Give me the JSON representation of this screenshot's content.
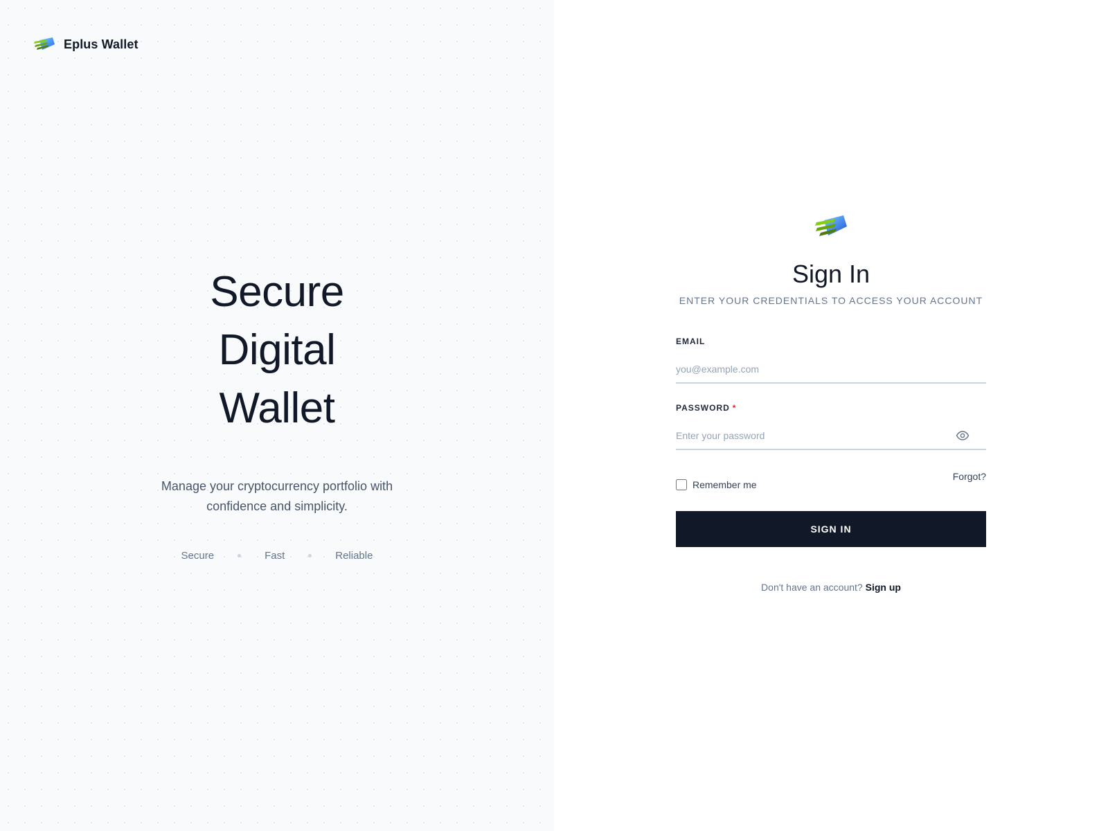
{
  "brand": {
    "name": "Eplus Wallet",
    "logo_icon": "wallet-card-logo-icon",
    "colors": {
      "green": "#7ac142",
      "blue": "#2563eb",
      "dark": "#111827"
    }
  },
  "hero": {
    "title_lines": [
      "Secure",
      "Digital",
      "Wallet"
    ],
    "subtitle_lines": [
      "Manage your cryptocurrency portfolio with",
      "confidence and simplicity."
    ],
    "features": [
      "Secure",
      "Fast",
      "Reliable"
    ]
  },
  "signin": {
    "title": "Sign In",
    "subtitle": "ENTER YOUR CREDENTIALS TO ACCESS YOUR ACCOUNT",
    "email": {
      "label": "EMAIL",
      "placeholder": "you@example.com",
      "value": ""
    },
    "password": {
      "label": "PASSWORD",
      "required_mark": "*",
      "placeholder": "Enter your password",
      "value": "",
      "toggle_icon": "eye-icon"
    },
    "remember_label": "Remember me",
    "remember_checked": false,
    "forgot_label": "Forgot?",
    "submit_label": "SIGN IN",
    "signup_prompt": "Don't have an account?",
    "signup_link": "Sign up"
  }
}
